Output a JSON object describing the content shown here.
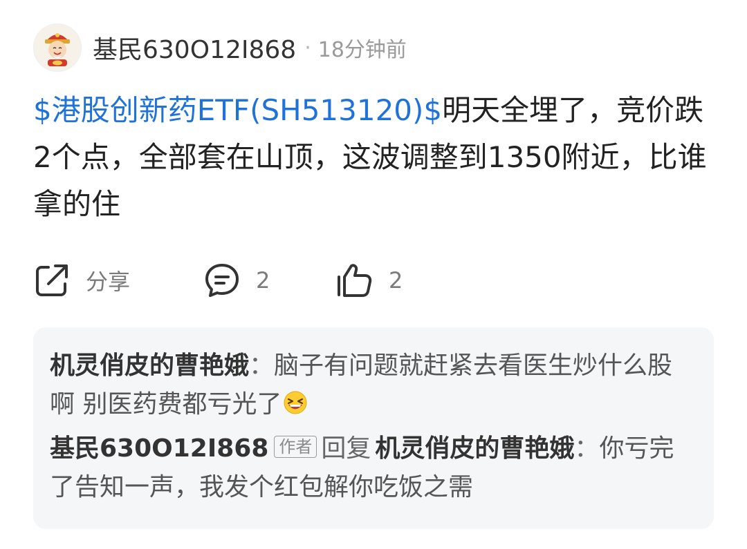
{
  "post": {
    "author": "基民630O12I868",
    "separator": "·",
    "time": "18分钟前",
    "stock_tag": "$港股创新药ETF(SH513120)$",
    "text": "明天全埋了，竞价跌2个点，全部套在山顶，这波调整到1350附近，比谁拿的住"
  },
  "actions": {
    "share_label": "分享",
    "comment_count": "2",
    "like_count": "2"
  },
  "comments": [
    {
      "author": "机灵俏皮的曹艳娥",
      "separator": "：",
      "text": "脑子有问题就赶紧去看医生炒什么股啊  别医药费都亏光了",
      "emoji": "laughing-emoji"
    },
    {
      "author": "基民630O12I868",
      "badge": "作者",
      "reply_word": "回复",
      "reply_to": "机灵俏皮的曹艳娥",
      "separator": "：",
      "text": "你亏完了告知一声，我发个红包解你吃饭之需"
    }
  ],
  "colors": {
    "stock_link": "#1f72d8",
    "comment_bg": "#f5f6f8",
    "muted_text": "#9a9a9a"
  }
}
